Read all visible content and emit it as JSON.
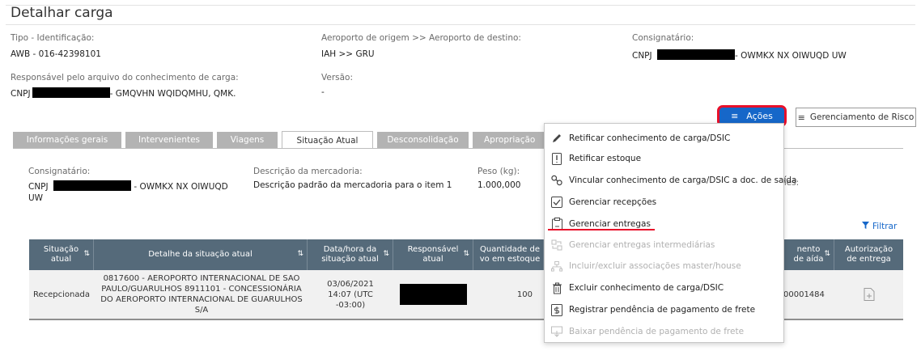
{
  "page": {
    "title": "Detalhar carga"
  },
  "header_fields": {
    "tipo": {
      "label": "Tipo - Identificação:",
      "value": "AWB - 016-42398101"
    },
    "aeroporto": {
      "label": "Aeroporto de origem >> Aeroporto de destino:",
      "value": "IAH >> GRU"
    },
    "consignatario": {
      "label": "Consignatário:",
      "prefix": "CNPJ",
      "suffix": "- OWMKX NX OIWUQD UW"
    },
    "responsavel": {
      "label": "Responsável pelo arquivo do conhecimento de carga:",
      "prefix": "CNPJ",
      "suffix": "- GMQVHN WQIDQMHU, QMK."
    },
    "versao": {
      "label": "Versão:",
      "value": "-"
    }
  },
  "buttons": {
    "acoes": "Ações",
    "risco": "Gerenciamento de Risco"
  },
  "tabs": [
    {
      "label": "Informações gerais",
      "active": false
    },
    {
      "label": "Intervenientes",
      "active": false
    },
    {
      "label": "Viagens",
      "active": false
    },
    {
      "label": "Situação Atual",
      "active": true
    },
    {
      "label": "Desconsolidação",
      "active": false
    },
    {
      "label": "Apropriação",
      "active": false
    }
  ],
  "situacao": {
    "consignatario": {
      "label": "Consignatário:",
      "prefix": "CNPJ",
      "suffix": "- OWMKX NX OIWUQD",
      "line2": "UW"
    },
    "descricao": {
      "label": "Descrição da mercadoria:",
      "value": "Descrição padrão da mercadoria para o item 1"
    },
    "peso": {
      "label": "Peso (kg):",
      "value": "1.000,000"
    },
    "nes_label": "nes:"
  },
  "filtrar": "Filtrar",
  "table": {
    "headers": [
      "Situação atual",
      "Detalhe da situação atual",
      "Data/hora da situação atual",
      "Responsável atual",
      "Quantidade de vo em estoque",
      "nento de aída",
      "Autorização de entrega"
    ],
    "row": {
      "situacao": "Recepcionada",
      "detalhe": "0817600 - AEROPORTO INTERNACIONAL DE SAO PAULO/GUARULHOS 8911101 - CONCESSIONÁRIA DO AEROPORTO INTERNACIONAL DE GUARULHOS S/A",
      "data": "03/06/2021 14:07 (UTC -03:00)",
      "quantidade": "100",
      "documento": "00001484"
    }
  },
  "menu": {
    "items": [
      {
        "label": "Retificar conhecimento de carga/DSIC",
        "icon": "pencil-icon",
        "disabled": false
      },
      {
        "label": "Retificar estoque",
        "icon": "file-alert-icon",
        "disabled": false
      },
      {
        "label": "Vincular conhecimento de carga/DSIC a doc. de saída",
        "icon": "link-icon",
        "disabled": false
      },
      {
        "label": "Gerenciar recepções",
        "icon": "checkbox-icon",
        "disabled": false
      },
      {
        "label": "Gerenciar entregas",
        "icon": "clipboard-icon",
        "disabled": false
      },
      {
        "label": "Gerenciar entregas intermediárias",
        "icon": "transfer-icon",
        "disabled": true
      },
      {
        "label": "Incluir/excluir associações master/house",
        "icon": "hierarchy-icon",
        "disabled": true
      },
      {
        "label": "Excluir conhecimento de carga/DSIC",
        "icon": "trash-icon",
        "disabled": false
      },
      {
        "label": "Registrar pendência de pagamento de frete",
        "icon": "payment-icon",
        "disabled": false
      },
      {
        "label": "Baixar pendência de pagamento de frete",
        "icon": "download-payment-icon",
        "disabled": true
      }
    ]
  },
  "colors": {
    "primary": "#1667c9",
    "highlight": "#e8102a",
    "table_header": "#556a7a"
  }
}
